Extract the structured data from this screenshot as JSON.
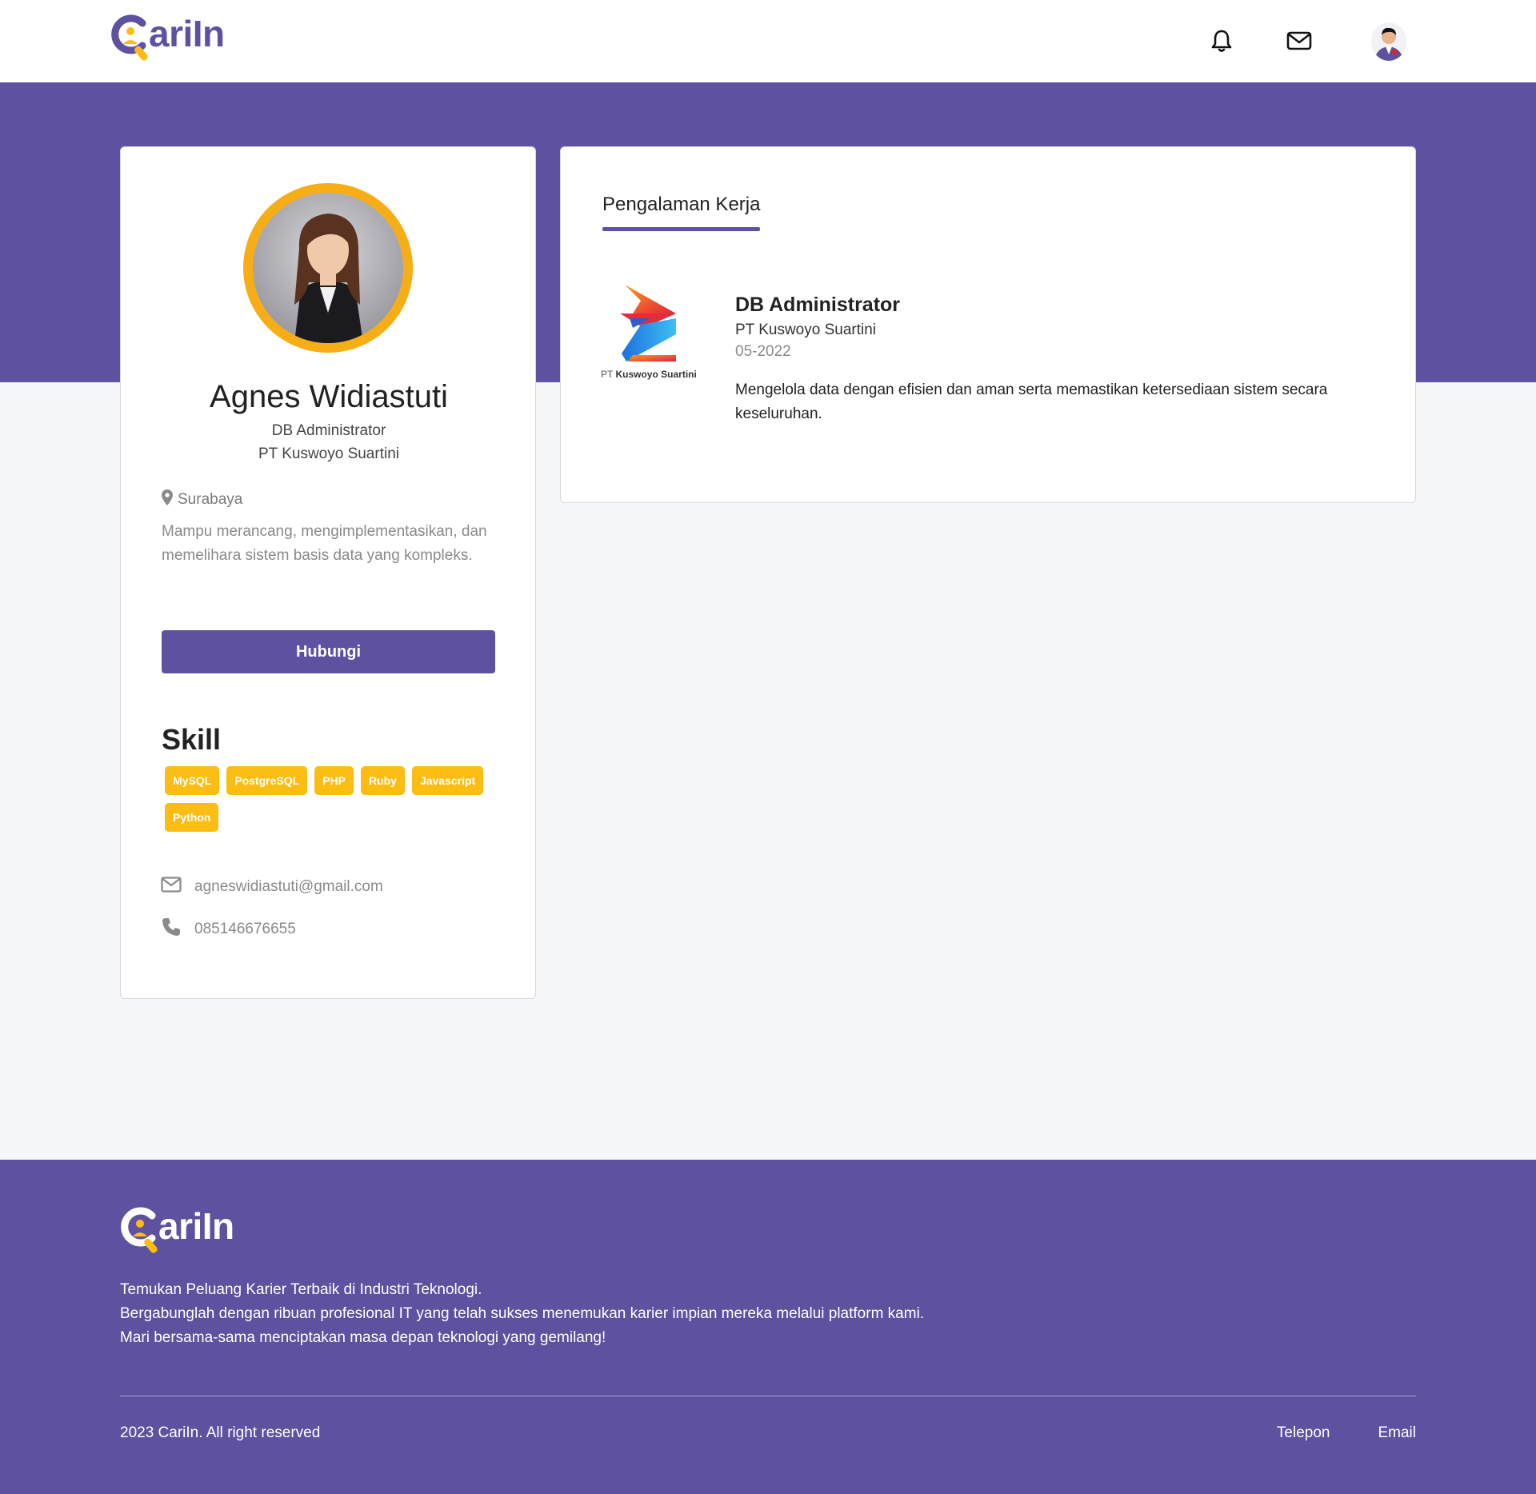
{
  "brand": {
    "name": "CariIn",
    "word": "ariIn",
    "accent": "#5e51a0",
    "highlight": "#fbbd14"
  },
  "navbar": {
    "icons": [
      "bell-icon",
      "mail-icon"
    ],
    "avatar": "user-avatar"
  },
  "profile": {
    "name": "Agnes Widiastuti",
    "role": "DB Administrator",
    "company": "PT Kuswoyo Suartini",
    "location": "Surabaya",
    "bio": "Mampu merancang, mengimplementasikan, dan memelihara sistem basis data yang kompleks.",
    "contact_button": "Hubungi",
    "skill_title": "Skill",
    "skills": [
      "MySQL",
      "PostgreSQL",
      "PHP",
      "Ruby",
      "Javascript",
      "Python"
    ],
    "email": "agneswidiastuti@gmail.com",
    "phone": "085146676655"
  },
  "experience": {
    "tab": "Pengalaman Kerja",
    "items": [
      {
        "logo_prefix": "PT",
        "logo_name": "Kuswoyo Suartini",
        "title": "DB Administrator",
        "company": "PT Kuswoyo Suartini",
        "date": "05-2022",
        "description": "Mengelola data dengan efisien dan aman serta memastikan ketersediaan sistem secara keseluruhan."
      }
    ]
  },
  "footer": {
    "tagline": [
      "Temukan Peluang Karier Terbaik di Industri Teknologi.",
      "Bergabunglah dengan ribuan profesional IT yang telah sukses menemukan karier impian mereka melalui platform kami.",
      "Mari bersama-sama menciptakan masa depan teknologi yang gemilang!"
    ],
    "copyright": "2023 CariIn. All right reserved",
    "links": [
      "Telepon",
      "Email"
    ]
  }
}
